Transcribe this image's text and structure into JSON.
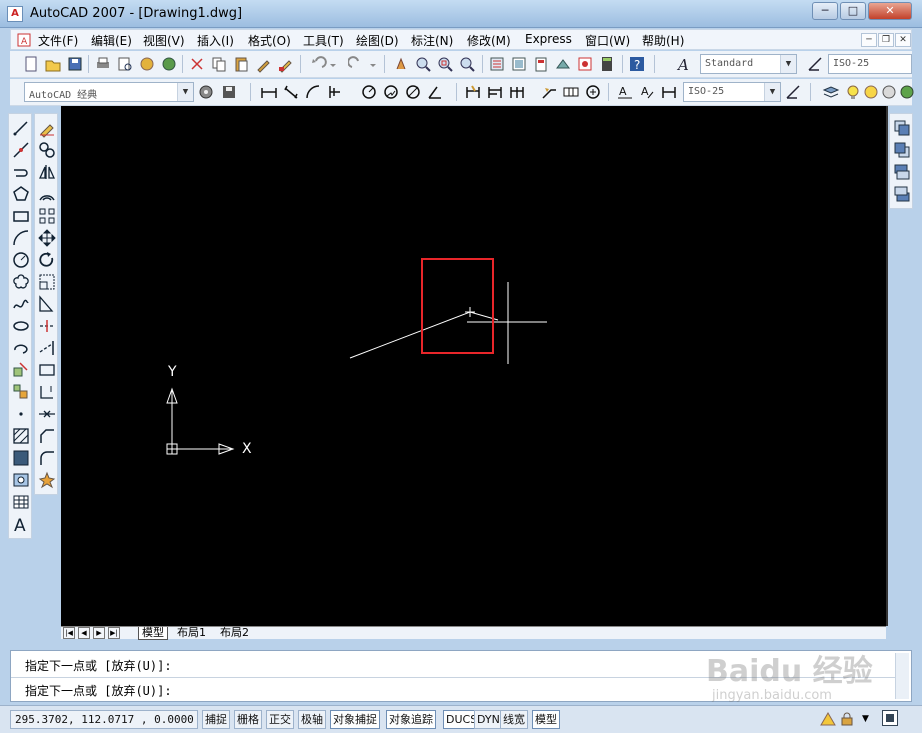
{
  "window": {
    "title": "AutoCAD 2007 - [Drawing1.dwg]",
    "app_icon": "autocad-logo",
    "minimize": "─",
    "maximize": "□",
    "close": "✕"
  },
  "menu": {
    "items": [
      "文件(F)",
      "编辑(E)",
      "视图(V)",
      "插入(I)",
      "格式(O)",
      "工具(T)",
      "绘图(D)",
      "标注(N)",
      "修改(M)",
      "Express",
      "窗口(W)",
      "帮助(H)"
    ],
    "doc_minimize": "─",
    "doc_restore": "❐",
    "doc_close": "✕"
  },
  "toolbar1": {
    "text_style": "Standard",
    "dim_style": "ISO-25"
  },
  "toolbar2": {
    "workspace": "AutoCAD 经典",
    "dim_style2": "ISO-25"
  },
  "ucs": {
    "x_label": "X",
    "y_label": "Y"
  },
  "layout_tabs": {
    "nav": [
      "|◀",
      "◀",
      "▶",
      "▶|"
    ],
    "tabs": [
      "模型",
      "布局1",
      "布局2"
    ]
  },
  "command": {
    "line1": "指定下一点或 [放弃(U)]:",
    "line2": "指定下一点或 [放弃(U)]:"
  },
  "status": {
    "coords": "295.3702,  112.0717 , 0.0000",
    "toggles": [
      "捕捉",
      "栅格",
      "正交",
      "极轴",
      "对象捕捉",
      "对象追踪",
      "DUCS",
      "DYN",
      "线宽",
      "模型"
    ]
  },
  "watermark": {
    "line1": "Baidu 经验",
    "line2": "jingyan.baidu.com"
  },
  "colors": {
    "canvas": "#000000",
    "highlight_box": "#e8262a",
    "drawing_line": "#ffffff"
  }
}
